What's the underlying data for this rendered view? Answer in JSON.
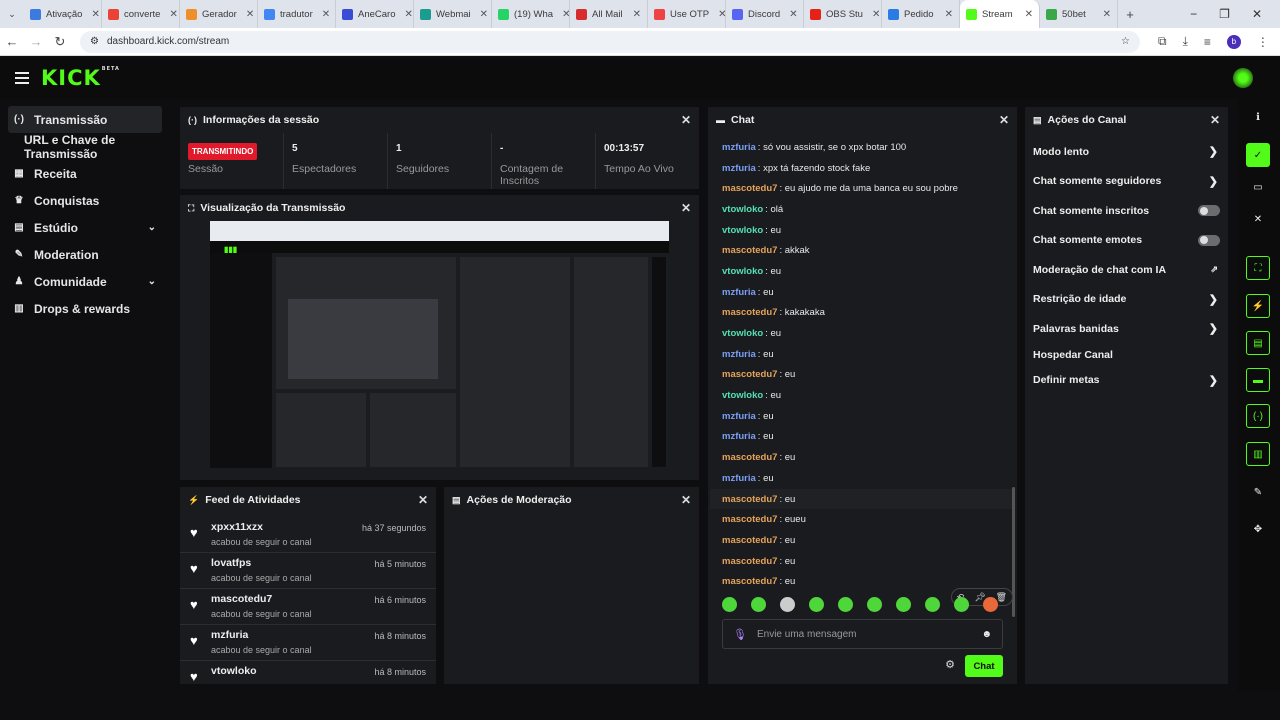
{
  "browser": {
    "tabs": [
      {
        "label": "Ativação",
        "color": "#3d7ae0"
      },
      {
        "label": "converte",
        "color": "#ea4335"
      },
      {
        "label": "Gerador",
        "color": "#ef8f2a"
      },
      {
        "label": "tradutor",
        "color": "#4285f4"
      },
      {
        "label": "AneCaro",
        "color": "#3a4bd6"
      },
      {
        "label": "Webmai",
        "color": "#1a9c8f"
      },
      {
        "label": "(19) Wha",
        "color": "#25d366"
      },
      {
        "label": "All Mail",
        "color": "#d62e2e"
      },
      {
        "label": "Use OTP",
        "color": "#e44"
      },
      {
        "label": "Discord",
        "color": "#5865f2"
      },
      {
        "label": "OBS Stu",
        "color": "#e62117"
      },
      {
        "label": "Pedido",
        "color": "#2a7be4"
      },
      {
        "label": "Stream",
        "color": "#53fc18"
      },
      {
        "label": "50bet",
        "color": "#3aa84a"
      }
    ],
    "url": "dashboard.kick.com/stream"
  },
  "header": {
    "logo": "KICK",
    "beta": "BETA"
  },
  "sidebar": {
    "items": [
      {
        "label": "Transmissão",
        "icon": "broadcast-icon"
      },
      {
        "label": "URL e Chave de Transmissão"
      },
      {
        "label": "Receita",
        "icon": "revenue-icon"
      },
      {
        "label": "Conquistas",
        "icon": "trophy-icon"
      },
      {
        "label": "Estúdio",
        "icon": "studio-icon"
      },
      {
        "label": "Moderation",
        "icon": "wrench-icon"
      },
      {
        "label": "Comunidade",
        "icon": "community-icon"
      },
      {
        "label": "Drops & rewards",
        "icon": "drops-icon"
      }
    ]
  },
  "session": {
    "title": "Informações da sessão",
    "badge": "TRANSMITINDO",
    "stats": [
      {
        "value": "",
        "label": "Sessão"
      },
      {
        "value": "5",
        "label": "Espectadores"
      },
      {
        "value": "1",
        "label": "Seguidores"
      },
      {
        "value": "-",
        "label": "Contagem de Inscritos"
      },
      {
        "value": "00:13:57",
        "label": "Tempo Ao Vivo"
      }
    ]
  },
  "preview": {
    "title": "Visualização da Transmissão"
  },
  "feed": {
    "title": "Feed de Atividades",
    "items": [
      {
        "name": "xpxx11xzx",
        "sub": "acabou de seguir o canal",
        "time": "há 37 segundos"
      },
      {
        "name": "lovatfps",
        "sub": "acabou de seguir o canal",
        "time": "há 5 minutos"
      },
      {
        "name": "mascotedu7",
        "sub": "acabou de seguir o canal",
        "time": "há 6 minutos"
      },
      {
        "name": "mzfuria",
        "sub": "acabou de seguir o canal",
        "time": "há 8 minutos"
      },
      {
        "name": "vtowloko",
        "sub": "",
        "time": "há 8 minutos"
      }
    ]
  },
  "moderation": {
    "title": "Ações de Moderação"
  },
  "chat": {
    "title": "Chat",
    "messages": [
      {
        "user": "mzfuria",
        "text": "só vou assistir, se o xpx botar 100"
      },
      {
        "user": "mzfuria",
        "text": "xpx tá fazendo stock fake"
      },
      {
        "user": "mascotedu7",
        "text": "eu ajudo me da uma banca eu sou pobre"
      },
      {
        "user": "vtowloko",
        "text": "olá"
      },
      {
        "user": "vtowloko",
        "text": "eu"
      },
      {
        "user": "mascotedu7",
        "text": "akkak"
      },
      {
        "user": "vtowloko",
        "text": "eu"
      },
      {
        "user": "mzfuria",
        "text": "eu"
      },
      {
        "user": "mascotedu7",
        "text": "kakakaka"
      },
      {
        "user": "vtowloko",
        "text": "eu"
      },
      {
        "user": "mzfuria",
        "text": "eu"
      },
      {
        "user": "mascotedu7",
        "text": "eu"
      },
      {
        "user": "vtowloko",
        "text": "eu"
      },
      {
        "user": "mzfuria",
        "text": "eu"
      },
      {
        "user": "mzfuria",
        "text": "eu"
      },
      {
        "user": "mascotedu7",
        "text": "eu"
      },
      {
        "user": "mzfuria",
        "text": "eu"
      },
      {
        "user": "mascotedu7",
        "text": "eu"
      },
      {
        "user": "mascotedu7",
        "text": "eueu"
      },
      {
        "user": "mascotedu7",
        "text": "eu"
      },
      {
        "user": "mascotedu7",
        "text": "eu"
      },
      {
        "user": "mascotedu7",
        "text": "eu"
      }
    ],
    "placeholder": "Envie uma mensagem",
    "send": "Chat"
  },
  "actions": {
    "title": "Ações do Canal",
    "items": [
      {
        "label": "Modo lento",
        "kind": "arrow"
      },
      {
        "label": "Chat somente seguidores",
        "kind": "arrow"
      },
      {
        "label": "Chat somente inscritos",
        "kind": "toggle"
      },
      {
        "label": "Chat somente emotes",
        "kind": "toggle"
      },
      {
        "label": "Moderação de chat com IA",
        "kind": "external"
      },
      {
        "label": "Restrição de idade",
        "kind": "arrow"
      },
      {
        "label": "Palavras banidas",
        "kind": "arrow"
      },
      {
        "label": "Hospedar Canal",
        "kind": "none"
      },
      {
        "label": "Definir metas",
        "kind": "arrow"
      }
    ]
  }
}
